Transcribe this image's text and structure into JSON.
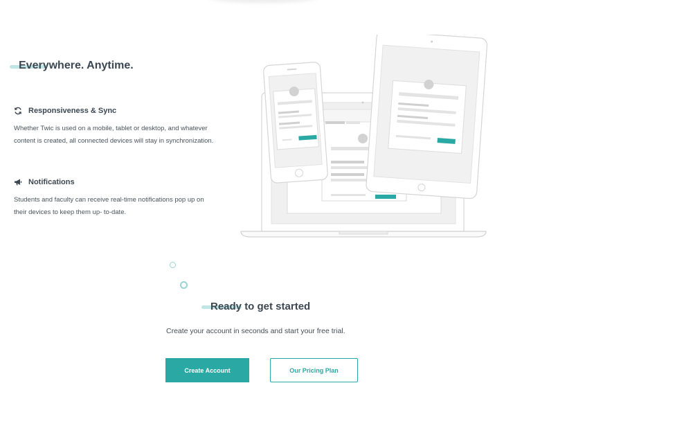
{
  "section": {
    "title": "Everywhere. Anytime."
  },
  "features": [
    {
      "icon": "sync-icon",
      "title": "Responsiveness & Sync",
      "text": "Whether Twic is used on a mobile, tablet or desktop, and whatever content is created, all connected devices will stay in synchronization."
    },
    {
      "icon": "megaphone-icon",
      "title": "Notifications",
      "text": "Students and faculty can receive real-time notifications pop up on their devices to keep them up- to-date."
    }
  ],
  "cta": {
    "title": "Ready to get started",
    "subtitle": "Create your account in seconds and start your free trial.",
    "primary_button": "Create Account",
    "secondary_button": "Our Pricing Plan"
  },
  "colors": {
    "accent": "#2aa8a4",
    "accent_light": "#bfe6e4",
    "heading": "#3c4751",
    "body_text": "#4a545c"
  }
}
